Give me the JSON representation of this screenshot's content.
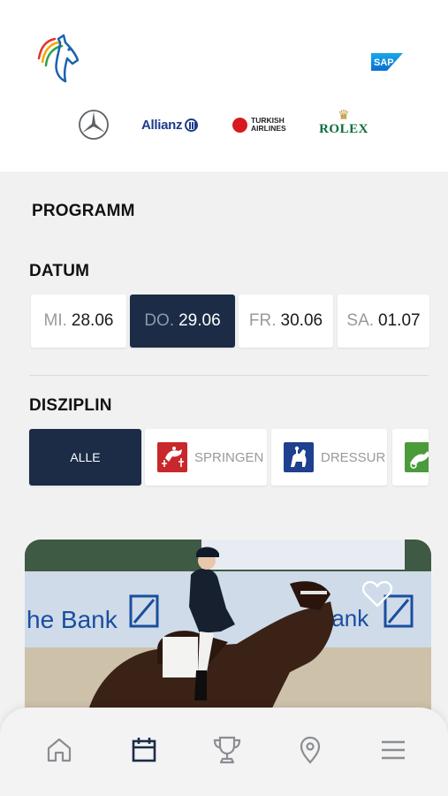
{
  "header": {
    "main_logo": "horse-logo-icon",
    "partner_logo": "SAP",
    "sponsors": {
      "mercedes": "mercedes-star-icon",
      "allianz": "Allianz",
      "turkish_line1": "TURKISH",
      "turkish_line2": "AIRLINES",
      "rolex": "ROLEX"
    }
  },
  "section_title": "PROGRAMM",
  "datum": {
    "label": "DATUM",
    "tabs": [
      {
        "day": "MI.",
        "date": "28.06",
        "active": false
      },
      {
        "day": "DO.",
        "date": "29.06",
        "active": true
      },
      {
        "day": "FR.",
        "date": "30.06",
        "active": false
      },
      {
        "day": "SA.",
        "date": "01.07",
        "active": false
      }
    ]
  },
  "disziplin": {
    "label": "DISZIPLIN",
    "tabs": [
      {
        "label": "ALLE",
        "active": true,
        "icon": null
      },
      {
        "label": "SPRINGEN",
        "active": false,
        "icon": "show-jumping-icon"
      },
      {
        "label": "DRESSUR",
        "active": false,
        "icon": "dressage-icon"
      },
      {
        "label": "",
        "active": false,
        "icon": "driving-icon"
      }
    ]
  },
  "event_card": {
    "banner_text_left": "he Bank",
    "banner_text_right": "Bank",
    "favorite_icon": "heart-icon"
  },
  "bottom_nav": [
    {
      "icon": "home-icon",
      "active": false
    },
    {
      "icon": "calendar-icon",
      "active": true
    },
    {
      "icon": "trophy-icon",
      "active": false
    },
    {
      "icon": "location-pin-icon",
      "active": false
    },
    {
      "icon": "menu-icon",
      "active": false
    }
  ],
  "colors": {
    "accent": "#1c2c46",
    "background": "#f1f1f2",
    "springen": "#c8282c",
    "dressur": "#1f3f8f",
    "fahren": "#4a9b3b"
  }
}
